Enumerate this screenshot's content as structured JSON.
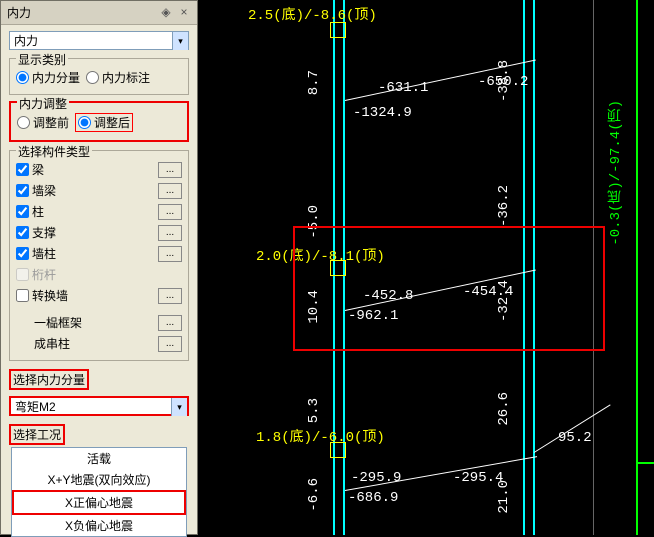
{
  "panel": {
    "title": "内力",
    "dropdown_main": "内力",
    "display": {
      "title": "显示类别",
      "opt1": "内力分量",
      "opt2": "内力标注"
    },
    "adjust": {
      "title": "内力调整",
      "opt1": "调整前",
      "opt2": "调整后"
    },
    "member": {
      "title": "选择构件类型",
      "items": [
        "梁",
        "墙梁",
        "柱",
        "支撑",
        "墙柱",
        "桁杆",
        "转换墙"
      ],
      "frame1": "一榀框架",
      "frame2": "成串柱"
    },
    "component_label": "选择内力分量",
    "component_value": "弯矩M2",
    "case_label": "选择工况",
    "cases": [
      "活载",
      "X+Y地震(双向效应)",
      "X正偏心地震",
      "X负偏心地震"
    ]
  },
  "canvas": {
    "story1": "2.5(底)/-8.6(顶)",
    "story2": "2.0(底)/-8.1(顶)",
    "story3": "1.8(底)/-6.0(顶)",
    "l1a": "-631.1",
    "l1b": "-650.2",
    "l1c": "-1324.9",
    "l2a": "-452.8",
    "l2b": "-454.4",
    "l2c": "-962.1",
    "l3a": "-295.9",
    "l3b": "-295.4",
    "l3c": "-686.9",
    "l3d": "95.2",
    "v1a": "8.7",
    "v1b": "-38.8",
    "v2a": "-5.0",
    "v2b": "-36.2",
    "v2c": "10.4",
    "v2d": "-32.4",
    "v3a": "5.3",
    "v3b": "26.6",
    "v3c": "-6.6",
    "v3d": "21.0",
    "g1": "-0.3(底)/-97.4(顶)"
  }
}
